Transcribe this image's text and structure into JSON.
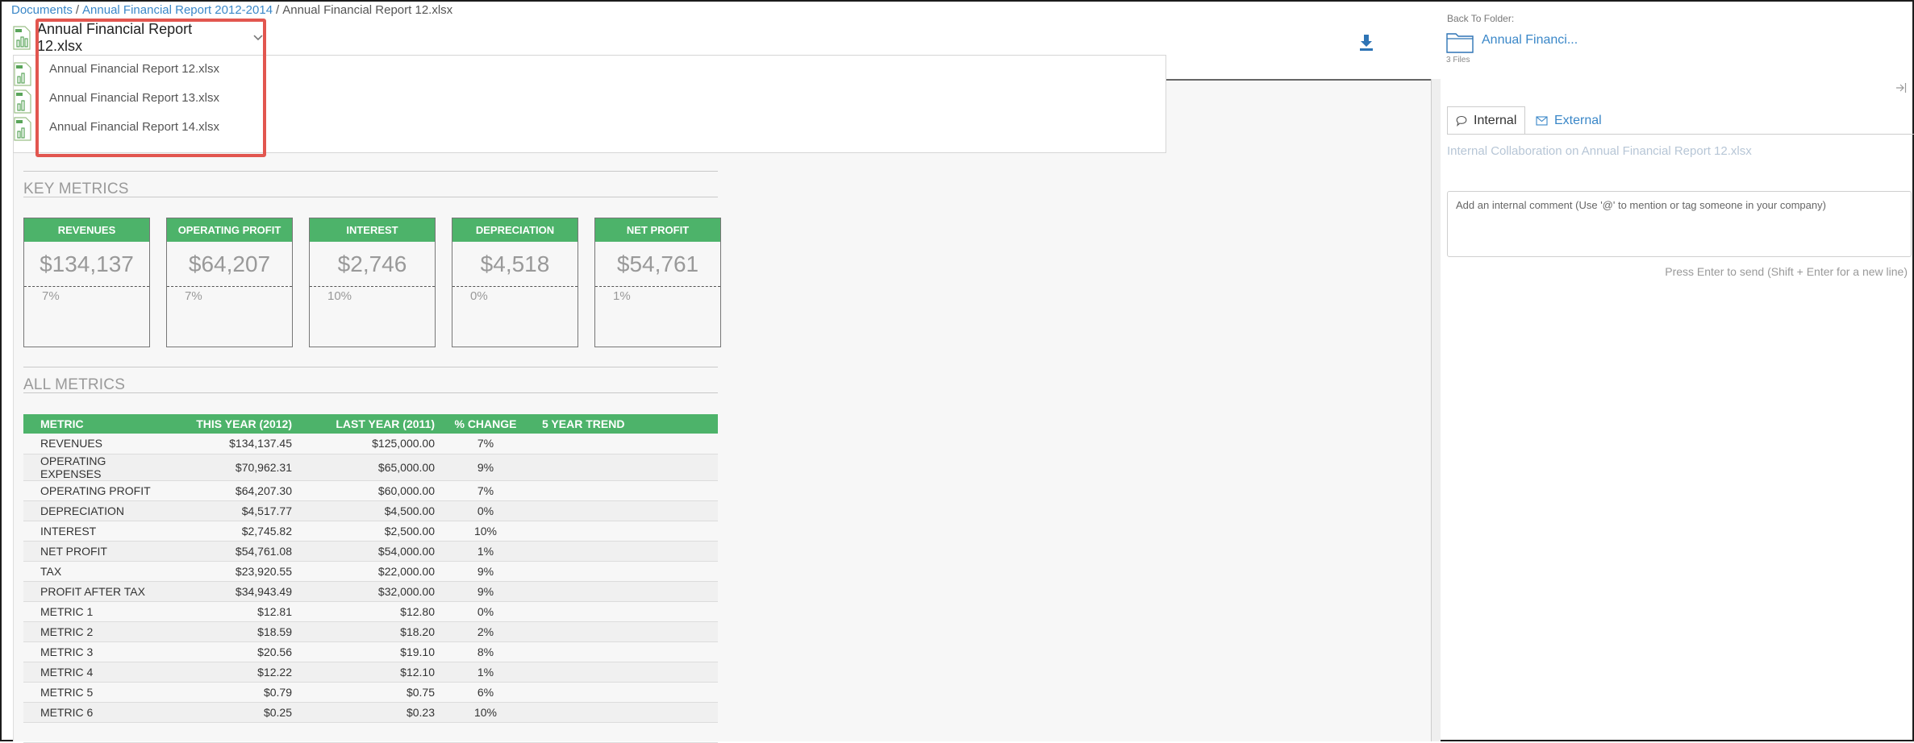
{
  "breadcrumb": {
    "root": "Documents",
    "folder": "Annual Financial Report 2012-2014",
    "current": "Annual Financial Report 12.xlsx"
  },
  "file_selector": {
    "selected": "Annual Financial Report 12.xlsx",
    "options": [
      "Annual Financial Report 12.xlsx",
      "Annual Financial Report 13.xlsx",
      "Annual Financial Report 14.xlsx"
    ]
  },
  "folder": {
    "label": "Back To Folder:",
    "name": "Annual Financi...",
    "count": "3 Files"
  },
  "key_metrics": {
    "title": "KEY METRICS",
    "cards": [
      {
        "label": "REVENUES",
        "value": "$134,137",
        "change": "7%"
      },
      {
        "label": "OPERATING PROFIT",
        "value": "$64,207",
        "change": "7%"
      },
      {
        "label": "INTEREST",
        "value": "$2,746",
        "change": "10%"
      },
      {
        "label": "DEPRECIATION",
        "value": "$4,518",
        "change": "0%"
      },
      {
        "label": "NET PROFIT",
        "value": "$54,761",
        "change": "1%"
      }
    ]
  },
  "all_metrics": {
    "title": "ALL METRICS",
    "headers": [
      "METRIC",
      "THIS YEAR (2012)",
      "LAST YEAR (2011)",
      "% CHANGE",
      "5 YEAR TREND"
    ],
    "rows": [
      [
        "REVENUES",
        "$134,137.45",
        "$125,000.00",
        "7%"
      ],
      [
        "OPERATING EXPENSES",
        "$70,962.31",
        "$65,000.00",
        "9%"
      ],
      [
        "OPERATING PROFIT",
        "$64,207.30",
        "$60,000.00",
        "7%"
      ],
      [
        "DEPRECIATION",
        "$4,517.77",
        "$4,500.00",
        "0%"
      ],
      [
        "INTEREST",
        "$2,745.82",
        "$2,500.00",
        "10%"
      ],
      [
        "NET PROFIT",
        "$54,761.08",
        "$54,000.00",
        "1%"
      ],
      [
        "TAX",
        "$23,920.55",
        "$22,000.00",
        "9%"
      ],
      [
        "PROFIT AFTER TAX",
        "$34,943.49",
        "$32,000.00",
        "9%"
      ],
      [
        "METRIC 1",
        "$12.81",
        "$12.80",
        "0%"
      ],
      [
        "METRIC 2",
        "$18.59",
        "$18.20",
        "2%"
      ],
      [
        "METRIC 3",
        "$20.56",
        "$19.10",
        "8%"
      ],
      [
        "METRIC 4",
        "$12.22",
        "$12.10",
        "1%"
      ],
      [
        "METRIC 5",
        "$0.79",
        "$0.75",
        "6%"
      ],
      [
        "METRIC 6",
        "$0.25",
        "$0.23",
        "10%"
      ]
    ]
  },
  "collaboration": {
    "tabs": [
      "Internal",
      "External"
    ],
    "title": "Internal Collaboration on Annual Financial Report 12.xlsx",
    "comment_placeholder": "Add an internal comment (Use '@' to mention or tag someone in your company)",
    "hint": "Press Enter to send (Shift + Enter for a new line)"
  },
  "colors": {
    "accent_green": "#4db36a",
    "link_blue": "#3a87c8",
    "highlight_red": "#e2564f"
  },
  "icons": [
    "file-xlsx-icon",
    "chevron-down-icon",
    "download-icon",
    "folder-icon",
    "collapse-panel-icon",
    "speech-bubble-icon",
    "envelope-icon"
  ]
}
